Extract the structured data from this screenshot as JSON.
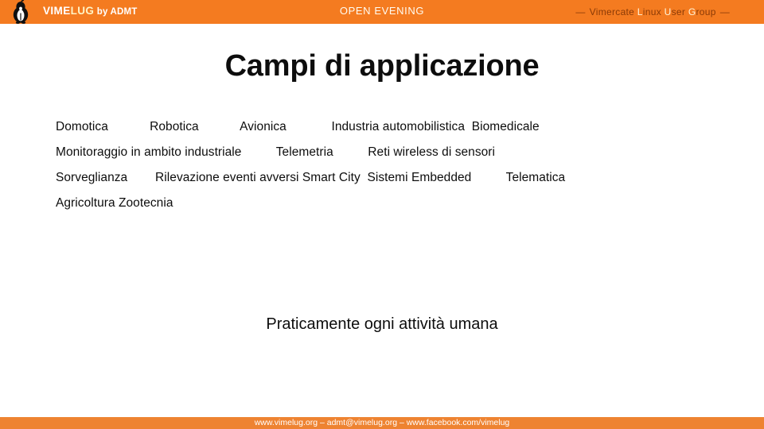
{
  "header": {
    "logo_icon": "penguin-logo-icon",
    "brand_part1": "VIME",
    "brand_part2": "LUG",
    "brand_suffix": "by ADMT",
    "event_title": "OPEN EVENING",
    "group_dash_left": "—",
    "group_dash_right": "—",
    "group_words": [
      {
        "initial": "V",
        "rest": "imercate",
        "highlighted": false
      },
      {
        "initial": "L",
        "rest": "inux",
        "highlighted": true
      },
      {
        "initial": "U",
        "rest": "ser",
        "highlighted": true
      },
      {
        "initial": "G",
        "rest": "roup",
        "highlighted": true
      }
    ],
    "colors": {
      "bar_background": "#F47B20",
      "brand_primary": "#FFFFFF",
      "brand_accent": "#FFF3C4",
      "group_dim": "#8A3A06",
      "group_highlight": "#FFF6DC"
    }
  },
  "slide": {
    "title": "Campi di applicazione",
    "body_lines": [
      "Domotica            Robotica            Avionica             Industria automobilistica  Biomedicale",
      "Monitoraggio in ambito industriale          Telemetria          Reti wireless di sensori",
      "Sorveglianza        Rilevazione eventi avversi Smart City  Sistemi Embedded          Telematica",
      "Agricoltura Zootecnia"
    ],
    "application_fields": [
      "Domotica",
      "Robotica",
      "Avionica",
      "Industria automobilistica",
      "Biomedicale",
      "Monitoraggio in ambito industriale",
      "Telemetria",
      "Reti wireless di sensori",
      "Sorveglianza",
      "Rilevazione eventi avversi",
      "Smart City",
      "Sistemi Embedded",
      "Telematica",
      "Agricoltura",
      "Zootecnia"
    ],
    "tagline": "Praticamente ogni attività umana"
  },
  "footer": {
    "text": "www.vimelug.org – admt@vimelug.org – www.facebook.com/vimelug",
    "background_color": "#EE8331",
    "text_color": "#FFFFFF"
  }
}
